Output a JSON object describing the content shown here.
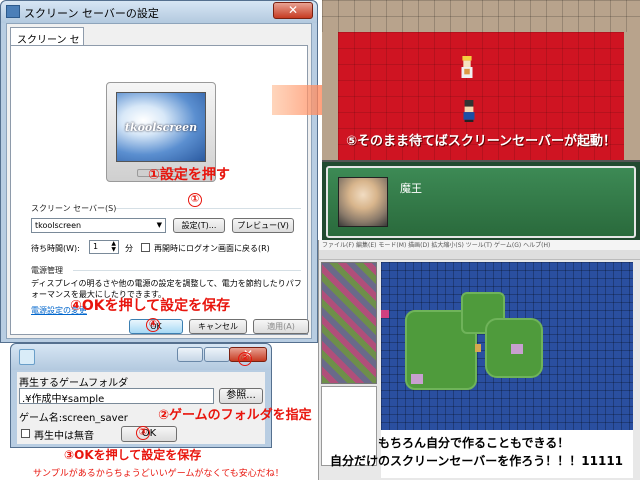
{
  "screensaver_dialog": {
    "title": "スクリーン セーバーの設定",
    "close_label": "✕",
    "tab_label": "スクリーン セーバー",
    "preview_text": "tkoolscreen",
    "group_label": "スクリーン セーバー(S)",
    "selected": "tkoolscreen",
    "settings_button": "設定(T)...",
    "preview_button": "プレビュー(V)",
    "wait_label": "待ち時間(W):",
    "wait_value": "1",
    "minutes_label": "分",
    "resume_label": "再開時にログオン画面に戻る(R)",
    "power_group": "電源管理",
    "power_text_1": "ディスプレイの明るさや他の電源の設定を調整して、電力を節約したりパフ",
    "power_text_2": "ォーマンスを最大にしたりできます。",
    "power_link": "電源設定の変更",
    "ok_button": "OK",
    "cancel_button": "キャンセル",
    "apply_button": "適用(A)"
  },
  "annotations": {
    "step1": "①設定を押す",
    "step2": "②ゲームのフォルダを指定",
    "step3": "③OKを押して設定を保存",
    "step4": "④OKを押して設定を保存",
    "step5": "⑤そのまま待てばスクリーンセーバーが起動！",
    "mark1": "①",
    "mark2": "②",
    "mark3": "③",
    "mark4": "④",
    "editor_line1": "もちろん自分で作ることもできる！",
    "editor_line2": "自分だけのスクリーンセーバーを作ろう！！！11111",
    "footnote": "サンプルがあるからちょうどいいゲームがなくても安心だね！"
  },
  "game": {
    "speaker": "魔王"
  },
  "game_folder_dialog": {
    "folder_label": "再生するゲームフォルダ",
    "folder_value": ".¥作成中¥sample",
    "browse_button": "参照...",
    "game_name": "ゲーム名:screen_saver",
    "mute_label": "再生中は無音",
    "ok_button": "OK"
  },
  "editor": {
    "menu_text": "ファイル(F)  編集(E)  モード(M)  描画(D)  拡大縮小(S)  ツール(T)  ゲーム(G)  ヘルプ(H)"
  },
  "colors": {
    "annotation_red": "#e8150d",
    "game_red": "#cf1422",
    "message_green": "#2a6a3c",
    "arrow_orange": "#ff5a2a"
  }
}
